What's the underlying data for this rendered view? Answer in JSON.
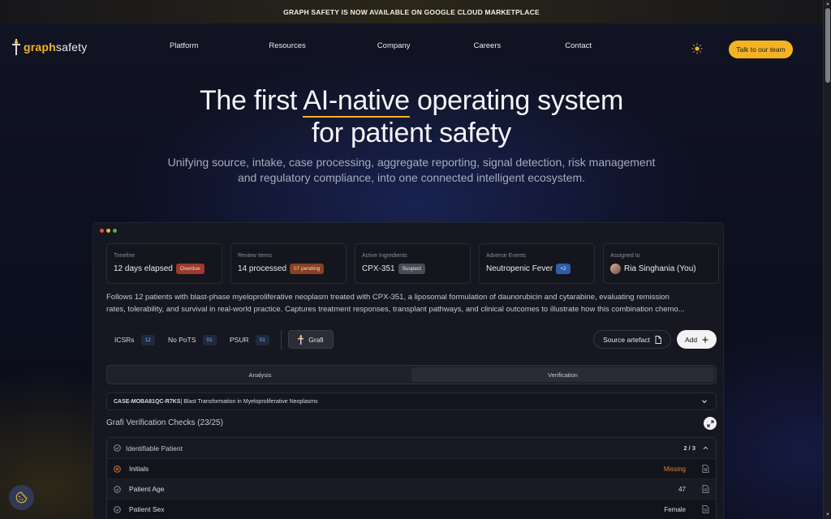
{
  "banner": {
    "text": "GRAPH SAFETY IS NOW AVAILABLE ON GOOGLE CLOUD MARKETPLACE"
  },
  "brand": {
    "graph": "graph",
    "safety": "safety"
  },
  "nav": {
    "links": [
      "Platform",
      "Resources",
      "Company",
      "Careers",
      "Contact"
    ],
    "cta": "Talk to our team",
    "theme_icon": "sun-icon"
  },
  "hero": {
    "title_pre": "The first ",
    "title_highlight": "AI-native",
    "title_post": " operating system",
    "title_line2": "for patient safety",
    "subtitle_line1": "Unifying source, intake, case processing, aggregate reporting, signal detection, risk management",
    "subtitle_line2": "and regulatory compliance, into one connected intelligent ecosystem."
  },
  "dashboard": {
    "window_dots": [
      "#e0533f",
      "#e3b23c",
      "#47b35a"
    ],
    "cards": [
      {
        "label": "Timeline",
        "value": "12 days elapsed",
        "badge": "Overdue",
        "badge_style": "red"
      },
      {
        "label": "Review Items",
        "value": "14 processed",
        "badge": "07 pending",
        "badge_style": "orange"
      },
      {
        "label": "Active Ingredients",
        "value": "CPX-351",
        "badge": "Suspect",
        "badge_style": "gray"
      },
      {
        "label": "Adverse Events",
        "value": "Neutropenic Fever",
        "badge": "+2",
        "badge_style": "blue"
      },
      {
        "label": "Assigned to",
        "value": "Ria Singhania (You)",
        "badge": "",
        "badge_style": ""
      }
    ],
    "description_line1": "Follows 12 patients with blast-phase myeloproliferative neoplasm treated with CPX-351, a liposomal formulation of daunorubicin and cytarabine, evaluating remission",
    "description_line2": "rates, tolerability, and survival in real-world practice. Captures treatment responses, transplant pathways, and clinical outcomes to illustrate how this combination chemo...",
    "filters": [
      {
        "label": "ICSRs",
        "count": "12"
      },
      {
        "label": "No PoTS",
        "count": "01"
      },
      {
        "label": "PSUR",
        "count": "01"
      }
    ],
    "grafi_label": "Grafi",
    "source_label": "Source artefact",
    "add_label": "Add",
    "segments": [
      "Analysis",
      "Verification"
    ],
    "active_segment": "Verification",
    "case_id": "CASE-MOBA81QC-R7KS",
    "case_title": " | Blast Transformation in Myeloproliferative Neoplasms",
    "checks_title": "Grafi Verification Checks (23/25)",
    "group": {
      "title": "Identifiable Patient",
      "progress": "2 / 3",
      "rows": [
        {
          "label": "Initials",
          "value": "Missing",
          "status": "missing"
        },
        {
          "label": "Patient Age",
          "value": "47",
          "status": "ok"
        },
        {
          "label": "Patient Sex",
          "value": "Female",
          "status": "ok"
        }
      ]
    }
  },
  "colors": {
    "accent": "#f4b324",
    "missing": "#e0813c"
  }
}
